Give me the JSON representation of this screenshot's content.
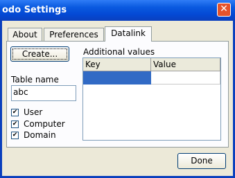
{
  "window": {
    "title": "odo Settings",
    "close_glyph": "✕"
  },
  "tabs": [
    {
      "label": "About",
      "active": false
    },
    {
      "label": "Preferences",
      "active": false
    },
    {
      "label": "Datalink",
      "active": true
    }
  ],
  "datalink": {
    "create_button": "Create...",
    "table_name_label": "Table name",
    "table_name_value": "abc",
    "checkboxes": [
      {
        "label": "User",
        "checked": true
      },
      {
        "label": "Computer",
        "checked": true
      },
      {
        "label": "Domain",
        "checked": true
      }
    ],
    "check_glyph": "✔",
    "grid_title": "Additional values",
    "columns": [
      "Key",
      "Value"
    ],
    "selection_color": "#316ac5"
  },
  "footer": {
    "done_button": "Done"
  }
}
